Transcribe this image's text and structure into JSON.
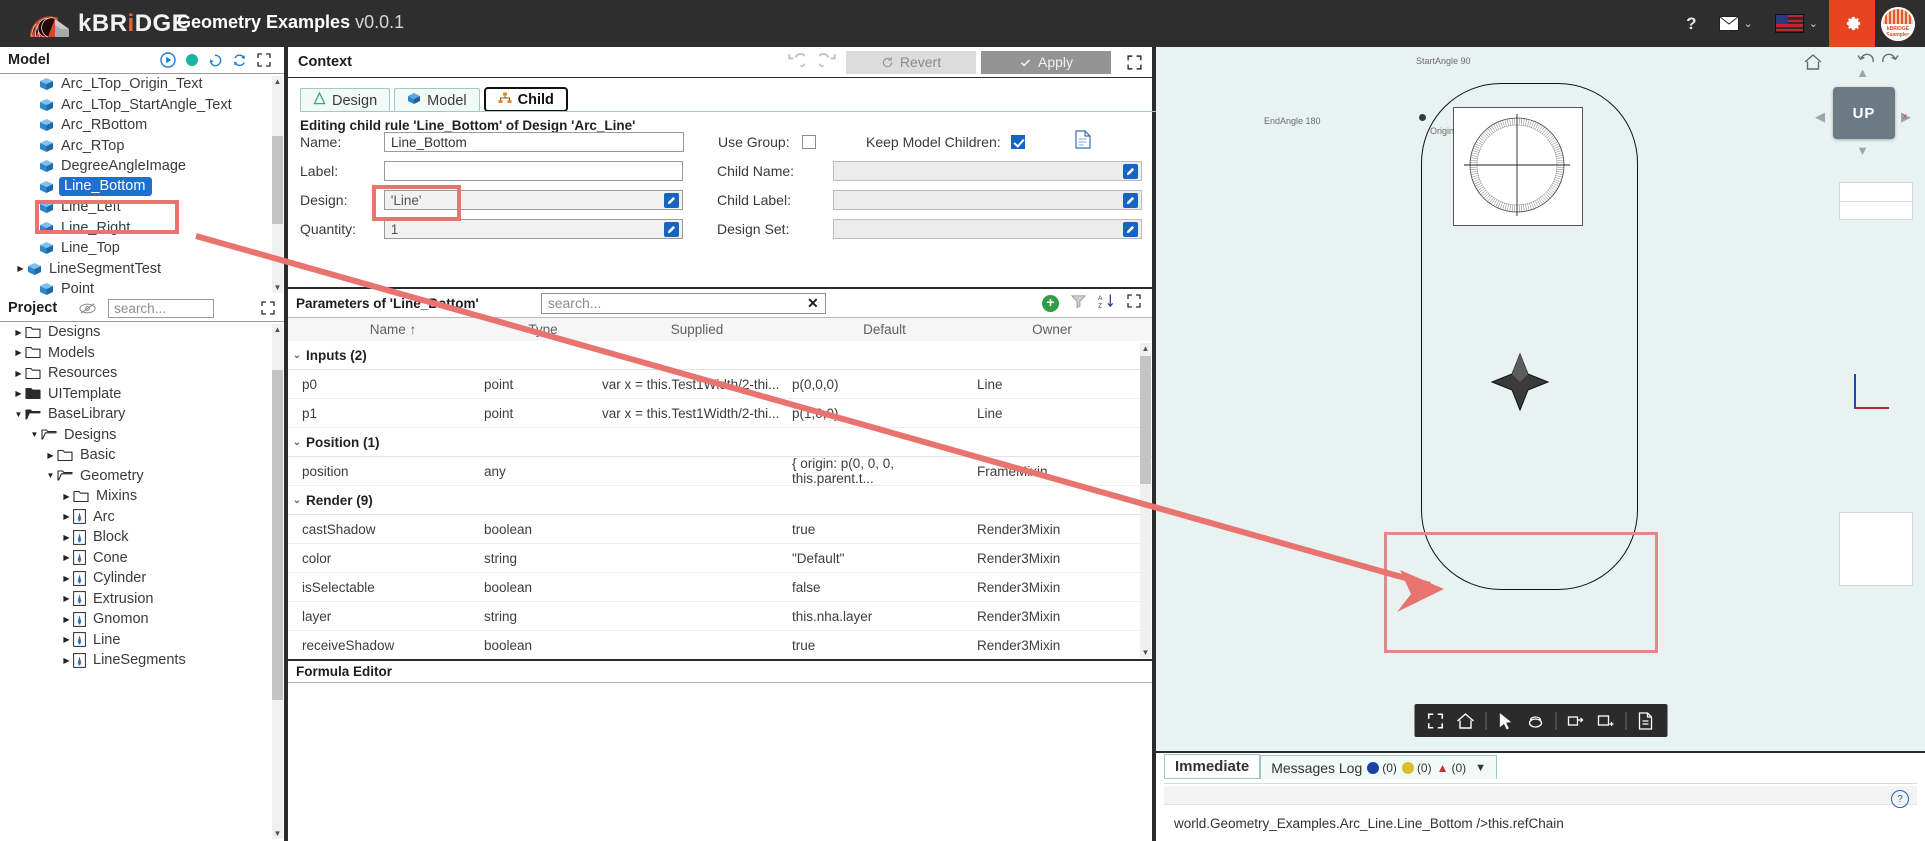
{
  "titlebar": {
    "brand_k": "k",
    "brand_b": "BR",
    "brand_i": "i",
    "brand_dge": "DGE",
    "app_title": "Geometry Examples",
    "app_version": "v0.0.1",
    "help_icon": "?",
    "mail_icon": "mail-icon",
    "flag_icon": "us-flag-icon",
    "gear_icon": "gear-icon",
    "avatar_label": "kBRiDGE Examples"
  },
  "model": {
    "title": "Model",
    "icons": [
      "play-icon",
      "record-icon",
      "history-icon",
      "refresh-icon",
      "expand-icon"
    ],
    "items": [
      {
        "label": "Arc_LTop_Origin_Text",
        "indent": 1,
        "arrow": "",
        "selected": false
      },
      {
        "label": "Arc_LTop_StartAngle_Text",
        "indent": 1,
        "arrow": "",
        "selected": false
      },
      {
        "label": "Arc_RBottom",
        "indent": 1,
        "arrow": "",
        "selected": false
      },
      {
        "label": "Arc_RTop",
        "indent": 1,
        "arrow": "",
        "selected": false
      },
      {
        "label": "DegreeAngleImage",
        "indent": 1,
        "arrow": "",
        "selected": false
      },
      {
        "label": "Line_Bottom",
        "indent": 1,
        "arrow": "",
        "selected": true
      },
      {
        "label": "Line_Left",
        "indent": 1,
        "arrow": "",
        "selected": false
      },
      {
        "label": "Line_Right",
        "indent": 1,
        "arrow": "",
        "selected": false
      },
      {
        "label": "Line_Top",
        "indent": 1,
        "arrow": "",
        "selected": false
      },
      {
        "label": "LineSegmentTest",
        "indent": 0,
        "arrow": "▶",
        "selected": false
      },
      {
        "label": "Point",
        "indent": 1,
        "arrow": "",
        "selected": false
      }
    ]
  },
  "project": {
    "title": "Project",
    "eye_icon": "eye-off-icon",
    "search_placeholder": "search...",
    "expand_icon": "expand-icon",
    "items": [
      {
        "label": "Designs",
        "indent": 0,
        "arrow": "▶",
        "kind": "folder"
      },
      {
        "label": "Models",
        "indent": 0,
        "arrow": "▶",
        "kind": "folder"
      },
      {
        "label": "Resources",
        "indent": 0,
        "arrow": "▶",
        "kind": "folder"
      },
      {
        "label": "UITemplate",
        "indent": 0,
        "arrow": "▶",
        "kind": "folder-solid"
      },
      {
        "label": "BaseLibrary",
        "indent": 0,
        "arrow": "▼",
        "kind": "folder-open-solid"
      },
      {
        "label": "Designs",
        "indent": 1,
        "arrow": "▼",
        "kind": "folder-open"
      },
      {
        "label": "Basic",
        "indent": 2,
        "arrow": "▶",
        "kind": "folder"
      },
      {
        "label": "Geometry",
        "indent": 2,
        "arrow": "▼",
        "kind": "folder-open"
      },
      {
        "label": "Mixins",
        "indent": 3,
        "arrow": "▶",
        "kind": "folder"
      },
      {
        "label": "Arc",
        "indent": 3,
        "arrow": "▶",
        "kind": "doc"
      },
      {
        "label": "Block",
        "indent": 3,
        "arrow": "▶",
        "kind": "doc"
      },
      {
        "label": "Cone",
        "indent": 3,
        "arrow": "▶",
        "kind": "doc"
      },
      {
        "label": "Cylinder",
        "indent": 3,
        "arrow": "▶",
        "kind": "doc"
      },
      {
        "label": "Extrusion",
        "indent": 3,
        "arrow": "▶",
        "kind": "doc"
      },
      {
        "label": "Gnomon",
        "indent": 3,
        "arrow": "▶",
        "kind": "doc"
      },
      {
        "label": "Line",
        "indent": 3,
        "arrow": "▶",
        "kind": "doc"
      },
      {
        "label": "LineSegments",
        "indent": 3,
        "arrow": "▶",
        "kind": "doc"
      }
    ]
  },
  "context": {
    "title": "Context",
    "undo_icon": "undo-icon",
    "redo_icon": "redo-icon",
    "revert_label": "Revert",
    "apply_label": "Apply",
    "expand_icon": "expand-icon",
    "tabs": [
      {
        "label": "Design",
        "icon": "design-icon",
        "active": false
      },
      {
        "label": "Model",
        "icon": "model-cube-icon",
        "active": false
      },
      {
        "label": "Child",
        "icon": "child-tree-icon",
        "active": true
      }
    ],
    "editing_text": "Editing child rule 'Line_Bottom' of Design 'Arc_Line'",
    "fields": {
      "name_label": "Name:",
      "name_value": "Line_Bottom",
      "label_label": "Label:",
      "label_value": "",
      "design_label": "Design:",
      "design_value": "'Line'",
      "quantity_label": "Quantity:",
      "quantity_value": "1",
      "use_group_label": "Use Group:",
      "child_name_label": "Child Name:",
      "child_name_value": "",
      "child_label_label": "Child Label:",
      "child_label_value": "",
      "design_set_label": "Design Set:",
      "design_set_value": "",
      "keep_model_children_label": "Keep Model Children:",
      "keep_model_children_checked": true,
      "use_group_checked": false,
      "doc_icon": "document-icon"
    }
  },
  "parameters": {
    "title": "Parameters of 'Line_Bottom'",
    "search_placeholder": "search...",
    "clear_icon": "clear-x-icon",
    "icons": [
      "add-icon",
      "filter-icon",
      "sort-az-icon",
      "expand-icon"
    ],
    "columns": [
      "Name ↑",
      "Type",
      "Supplied",
      "Default",
      "Owner"
    ],
    "rows": [
      {
        "group": true,
        "name": "Inputs (2)"
      },
      {
        "group": false,
        "name": "p0",
        "type": "point",
        "supplied": "var x = this.Test1Width/2-thi...",
        "default": "p(0,0,0)",
        "owner": "Line"
      },
      {
        "group": false,
        "name": "p1",
        "type": "point",
        "supplied": "var x = this.Test1Width/2-thi...",
        "default": "p(1,0,0)",
        "owner": "Line"
      },
      {
        "group": true,
        "name": "Position (1)"
      },
      {
        "group": false,
        "name": "position",
        "type": "any",
        "supplied": "",
        "default": "{ origin: p(0, 0, 0, this.parent.t...",
        "owner": "FrameMixin"
      },
      {
        "group": true,
        "name": "Render (9)"
      },
      {
        "group": false,
        "name": "castShadow",
        "type": "boolean",
        "supplied": "",
        "default": "true",
        "owner": "Render3Mixin"
      },
      {
        "group": false,
        "name": "color",
        "type": "string",
        "supplied": "",
        "default": "\"Default\"",
        "owner": "Render3Mixin"
      },
      {
        "group": false,
        "name": "isSelectable",
        "type": "boolean",
        "supplied": "",
        "default": "false",
        "owner": "Render3Mixin"
      },
      {
        "group": false,
        "name": "layer",
        "type": "string",
        "supplied": "",
        "default": "this.nha.layer",
        "owner": "Render3Mixin"
      },
      {
        "group": false,
        "name": "receiveShadow",
        "type": "boolean",
        "supplied": "",
        "default": "true",
        "owner": "Render3Mixin"
      }
    ]
  },
  "formula_editor": {
    "title": "Formula Editor"
  },
  "viewport": {
    "start_angle_label": "StartAngle 90",
    "end_angle_label": "EndAngle 180",
    "origin_label": "Origin",
    "nav_cube_label": "UP",
    "nav_axis_x": "x",
    "home_icon": "home-icon",
    "toolbar_icons": [
      "fit-icon",
      "home-icon",
      "select-arrow-icon",
      "orbit-icon",
      "pan-icon",
      "zoom-window-icon",
      "snapshot-icon"
    ]
  },
  "bottom": {
    "tabs": [
      {
        "label": "Immediate",
        "active": true
      },
      {
        "label": "Messages Log",
        "active": false
      }
    ],
    "badges": [
      {
        "icon": "info-icon",
        "count": "(0)",
        "color": "#1f3fa8"
      },
      {
        "icon": "warning-icon",
        "count": "(0)",
        "color": "#d6c12a"
      },
      {
        "icon": "error-icon",
        "count": "(0)",
        "color": "#d22b2b"
      }
    ],
    "chevron": "▼",
    "console_text": "world.Geometry_Examples.Arc_Line.Line_Bottom />this.refChain",
    "help_icon": "question-circle-icon"
  },
  "colors": {
    "brand_orange": "#e8441f",
    "selection_blue": "#1f6fd0",
    "annotation_red": "#e8736f",
    "viewport_bg": "#e8f3f1"
  }
}
